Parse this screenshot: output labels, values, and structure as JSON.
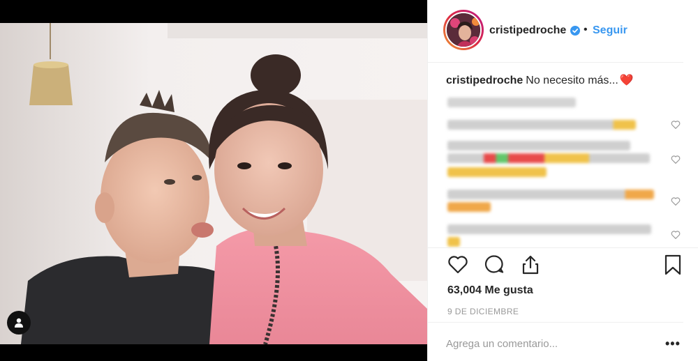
{
  "post": {
    "username": "cristipedroche",
    "follow_label": "Seguir",
    "separator": "•",
    "caption_text": "No necesito más...",
    "caption_emoji": "❤️",
    "likes": "63,004 Me gusta",
    "date": "9 DE DICIEMBRE"
  },
  "comment_box": {
    "placeholder": "Agrega un comentario...",
    "more_label": "•••"
  },
  "colors": {
    "accent_link": "#3897f0",
    "verified_badge": "#3897f0",
    "heart": "#e0162b",
    "meta_gray": "#999999"
  },
  "icons": [
    "user-tag-icon",
    "verified-badge-icon",
    "heart-icon",
    "comment-icon",
    "share-icon",
    "bookmark-icon",
    "like-comment-icon"
  ]
}
